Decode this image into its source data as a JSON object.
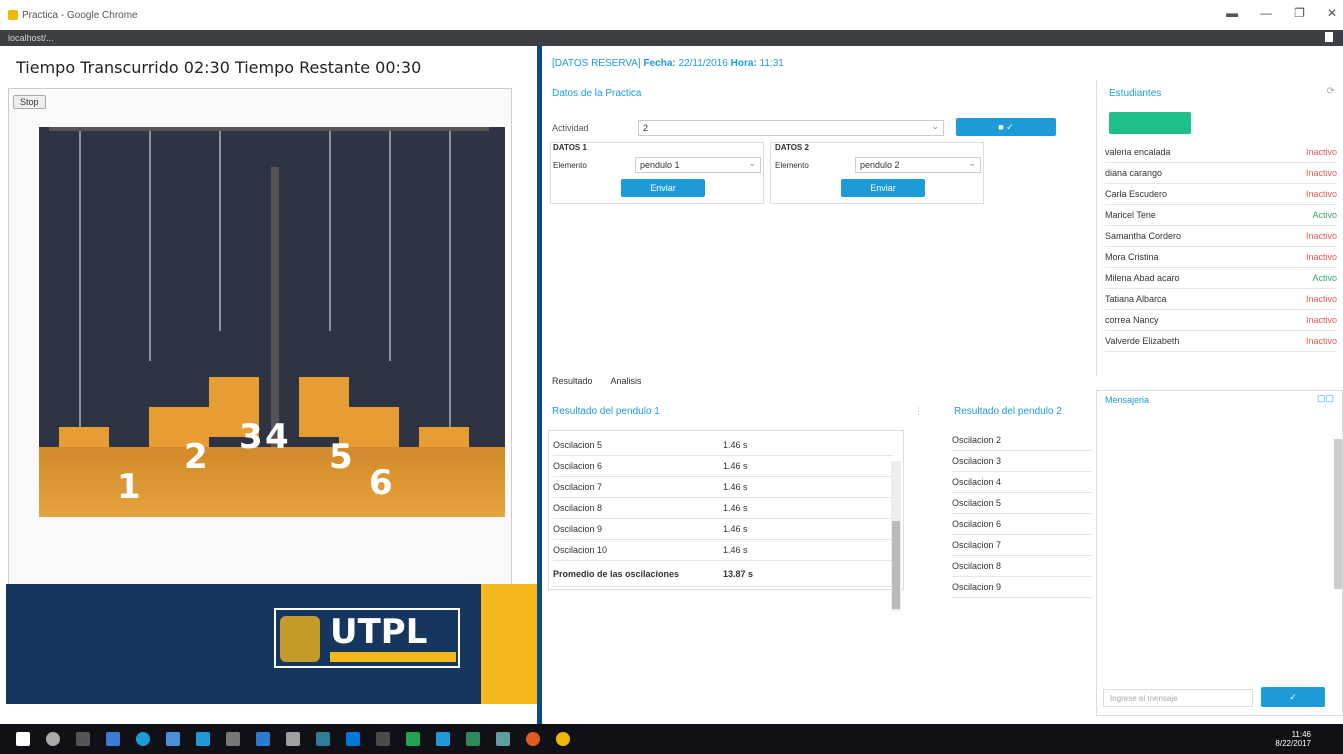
{
  "window": {
    "title": "Practica - Google Chrome",
    "url": "localhost/..."
  },
  "left": {
    "timer_text": "Tiempo Transcurrido 02:30  Tiempo Restante 00:30",
    "stop_label": "Stop",
    "pendulum_numbers": [
      "1",
      "2",
      "3",
      "4",
      "5",
      "6"
    ],
    "banner_logo": "UTPL"
  },
  "right": {
    "reserve_info": "[DATOS RESERVA] ",
    "fecha_label": "Fecha:",
    "fecha_value": "22/11/2016",
    "hora_label": "Hora:",
    "hora_value": "11:31",
    "practice_title": "Datos de la Practica",
    "actividad_label": "Actividad",
    "actividad_value": "2",
    "datos1_label": "DATOS 1",
    "datos2_label": "DATOS 2",
    "elemento_label": "Elemento",
    "pendulo1": "pendulo 1",
    "pendulo2": "pendulo 2",
    "enviar_label": "Enviar",
    "estudiantes_title": "Estudiantes",
    "students": [
      {
        "name": "valeria encalada",
        "status": "Inactivo",
        "active": false
      },
      {
        "name": "diana carango",
        "status": "Inactivo",
        "active": false
      },
      {
        "name": "Carla Escudero",
        "status": "Inactivo",
        "active": false
      },
      {
        "name": "Maricel Tene",
        "status": "Activo",
        "active": true
      },
      {
        "name": "Samantha Cordero",
        "status": "Inactivo",
        "active": false
      },
      {
        "name": "Mora Cristina",
        "status": "Inactivo",
        "active": false
      },
      {
        "name": "Milena Abad acaro",
        "status": "Activo",
        "active": true
      },
      {
        "name": "Tatiana Albarca",
        "status": "Inactivo",
        "active": false
      },
      {
        "name": "correa Nancy",
        "status": "Inactivo",
        "active": false
      },
      {
        "name": "Valverde Elizabeth",
        "status": "Inactivo",
        "active": false
      }
    ],
    "tabs": [
      "Resultado",
      "Analisis"
    ],
    "results1_title": "Resultado del pendulo 1",
    "results1": [
      {
        "label": "Oscilacion 5",
        "value": "1.46 s"
      },
      {
        "label": "Oscilacion 6",
        "value": "1.46 s"
      },
      {
        "label": "Oscilacion 7",
        "value": "1.46 s"
      },
      {
        "label": "Oscilacion 8",
        "value": "1.46 s"
      },
      {
        "label": "Oscilacion 9",
        "value": "1.46 s"
      },
      {
        "label": "Oscilacion 10",
        "value": "1.46 s"
      },
      {
        "label": "Promedio de las oscilaciones",
        "value": "13.87 s"
      }
    ],
    "results2_title": "Resultado del pendulo 2",
    "results2": [
      "Oscilacion 2",
      "Oscilacion 3",
      "Oscilacion 4",
      "Oscilacion 5",
      "Oscilacion 6",
      "Oscilacion 7",
      "Oscilacion 8",
      "Oscilacion 9"
    ],
    "chat_title": "Mensajeria",
    "chat_placeholder": "Ingrese el mensaje"
  },
  "taskbar": {
    "time": "11:46",
    "date": "8/22/2017"
  }
}
